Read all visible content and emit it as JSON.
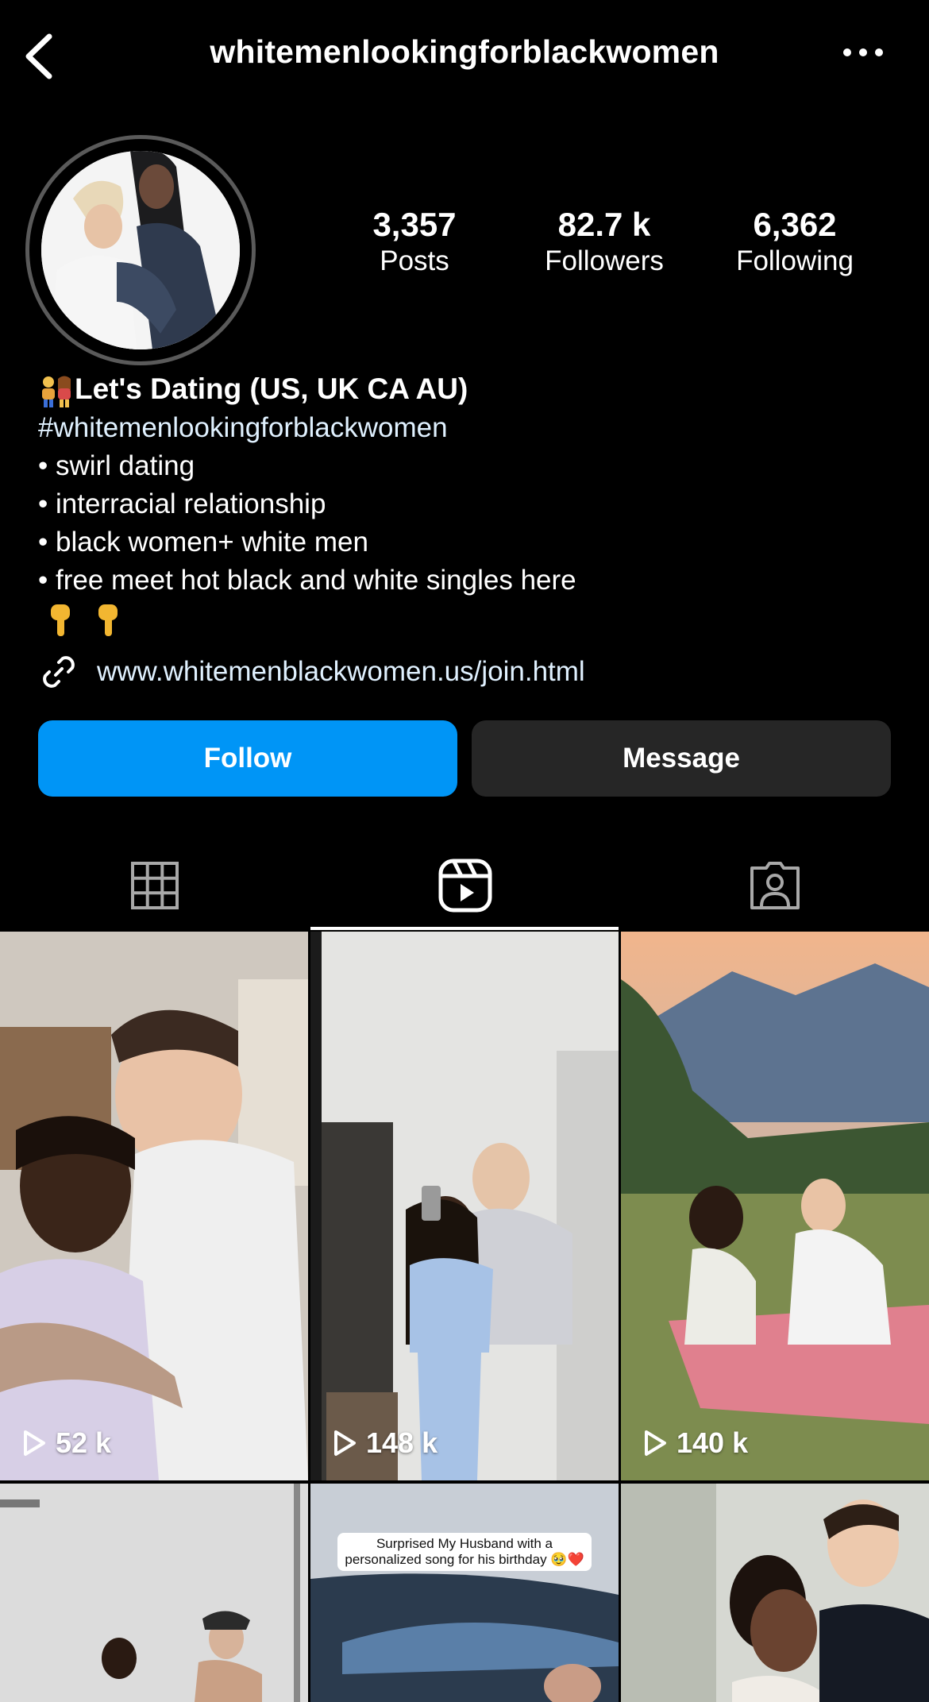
{
  "header": {
    "username": "whitemenlookingforblackwomen",
    "back_icon": "chevron-left-icon",
    "more_icon": "more-horizontal-icon"
  },
  "profile": {
    "stats": [
      {
        "value": "3,357",
        "label": "Posts"
      },
      {
        "value": "82.7 k",
        "label": "Followers"
      },
      {
        "value": "6,362",
        "label": "Following"
      }
    ],
    "bio": {
      "name": "Let's Dating (US, UK CA AU)",
      "hashtag": "#whitemenlookingforblackwomen",
      "lines": [
        "• swirl dating",
        "• interracial relationship",
        "• black women+ white men",
        "• free meet hot black and white singles here"
      ]
    },
    "link": "www.whitemenblackwomen.us/join.html"
  },
  "actions": {
    "follow_label": "Follow",
    "message_label": "Message",
    "follow_color": "#0095f6"
  },
  "tabs": [
    {
      "name": "grid",
      "icon": "grid-icon",
      "active": false
    },
    {
      "name": "reels",
      "icon": "reels-icon",
      "active": true
    },
    {
      "name": "tagged",
      "icon": "tagged-person-icon",
      "active": false
    }
  ],
  "reels": [
    {
      "views": "52 k"
    },
    {
      "views": "148 k"
    },
    {
      "views": "140 k"
    },
    {
      "views": ""
    },
    {
      "views": "",
      "caption": "Surprised My Husband with a personalized song for his birthday 🥹❤️"
    },
    {
      "views": ""
    }
  ]
}
